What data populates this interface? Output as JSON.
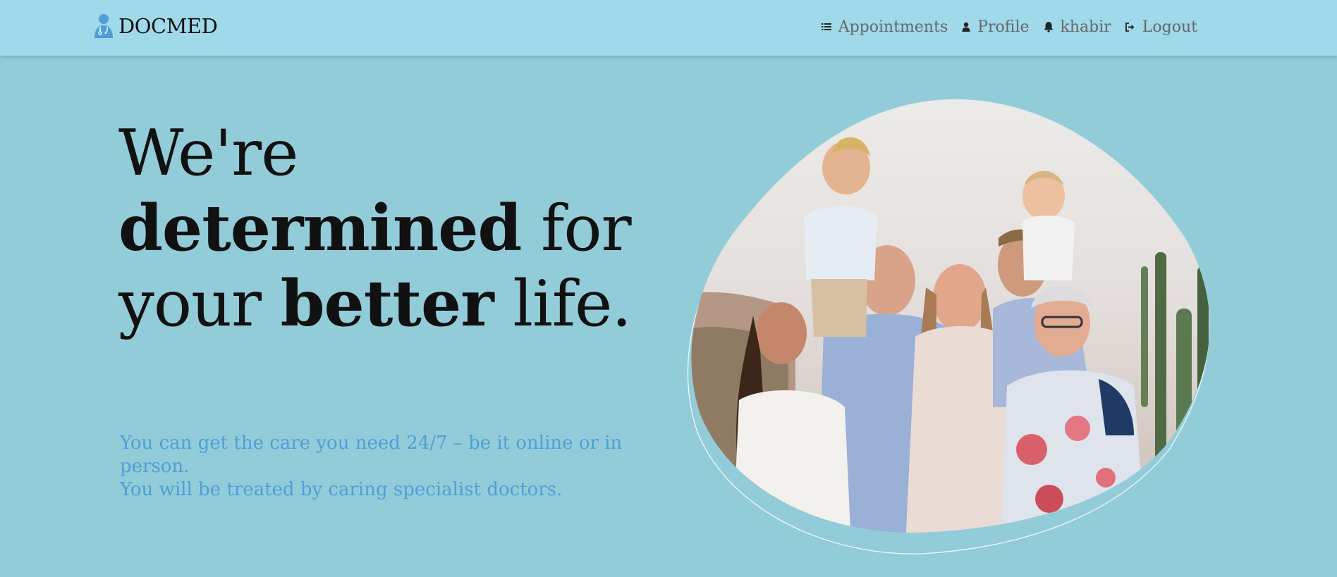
{
  "navbar": {
    "brand": "DOCMED",
    "brand_icon": "doctor-icon",
    "links": [
      {
        "label": "Appointments",
        "icon": "list-icon"
      },
      {
        "label": "Profile",
        "icon": "user-icon"
      },
      {
        "label": "khabir",
        "icon": "bell-icon"
      },
      {
        "label": "Logout",
        "icon": "logout-icon"
      }
    ]
  },
  "hero": {
    "title": {
      "w1": "We're",
      "w2": "determined",
      "w3": " for",
      "w4": "your ",
      "w5": "better",
      "w6": " life."
    },
    "text_line1": "You can get the care you need 24/7 – be it online or in person.",
    "text_line2": "You will be treated by caring specialist doctors.",
    "image": "family-photo"
  },
  "colors": {
    "page_bg": "#93ccd9",
    "navbar_bg": "#9fd9ea",
    "accent": "#4d9fd8",
    "heading": "#111111"
  }
}
